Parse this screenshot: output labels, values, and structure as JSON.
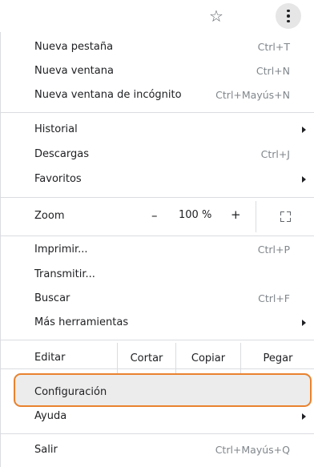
{
  "toolbar": {
    "bookmark_icon": "star-icon",
    "menu_icon": "kebab-menu-icon"
  },
  "menu": {
    "group1": [
      {
        "label": "Nueva pestaña",
        "shortcut": "Ctrl+T"
      },
      {
        "label": "Nueva ventana",
        "shortcut": "Ctrl+N"
      },
      {
        "label": "Nueva ventana de incógnito",
        "shortcut": "Ctrl+Mayús+N"
      }
    ],
    "group2": [
      {
        "label": "Historial"
      },
      {
        "label": "Descargas",
        "shortcut": "Ctrl+J"
      },
      {
        "label": "Favoritos"
      }
    ],
    "zoom": {
      "label": "Zoom",
      "minus": "–",
      "value": "100 %",
      "plus": "+"
    },
    "group3": [
      {
        "label": "Imprimir...",
        "shortcut": "Ctrl+P"
      },
      {
        "label": "Transmitir..."
      },
      {
        "label": "Buscar",
        "shortcut": "Ctrl+F"
      },
      {
        "label": "Más herramientas"
      }
    ],
    "edit": {
      "label": "Editar",
      "cut": "Cortar",
      "copy": "Copiar",
      "paste": "Pegar"
    },
    "group4": [
      {
        "label": "Configuración"
      },
      {
        "label": "Ayuda"
      }
    ],
    "exit": {
      "label": "Salir",
      "shortcut": "Ctrl+Mayús+Q"
    }
  },
  "colors": {
    "highlight_border": "#e8822e",
    "highlight_bg": "#ececec",
    "separator": "#dadce0"
  }
}
